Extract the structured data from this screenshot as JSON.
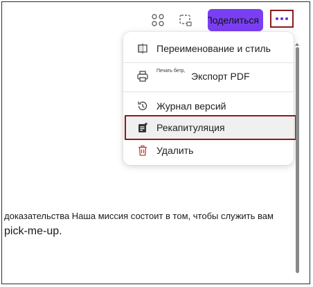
{
  "toolbar": {
    "share_label": "Поделиться",
    "icons": [
      "loop-icon",
      "region-select-icon",
      "more-icon"
    ]
  },
  "menu": {
    "items": [
      {
        "label": "Переименование и стиль",
        "icon": "rename-style-icon"
      },
      {
        "label": "Экспорт PDF",
        "icon": "printer-icon",
        "small_prefix": "Печать бетр,"
      },
      {
        "label": "Журнал версий",
        "icon": "history-icon"
      },
      {
        "label": "Рекапитуляция",
        "icon": "recap-icon"
      },
      {
        "label": "Удалить",
        "icon": "trash-icon"
      }
    ]
  },
  "content": {
    "line1": "доказательства Наша миссия состоит в том, чтобы служить вам",
    "line2": "pick-me-up."
  },
  "colors": {
    "accent": "#7a3ff2",
    "highlight_border": "#8b1a1a",
    "delete_icon": "#c0392b"
  }
}
